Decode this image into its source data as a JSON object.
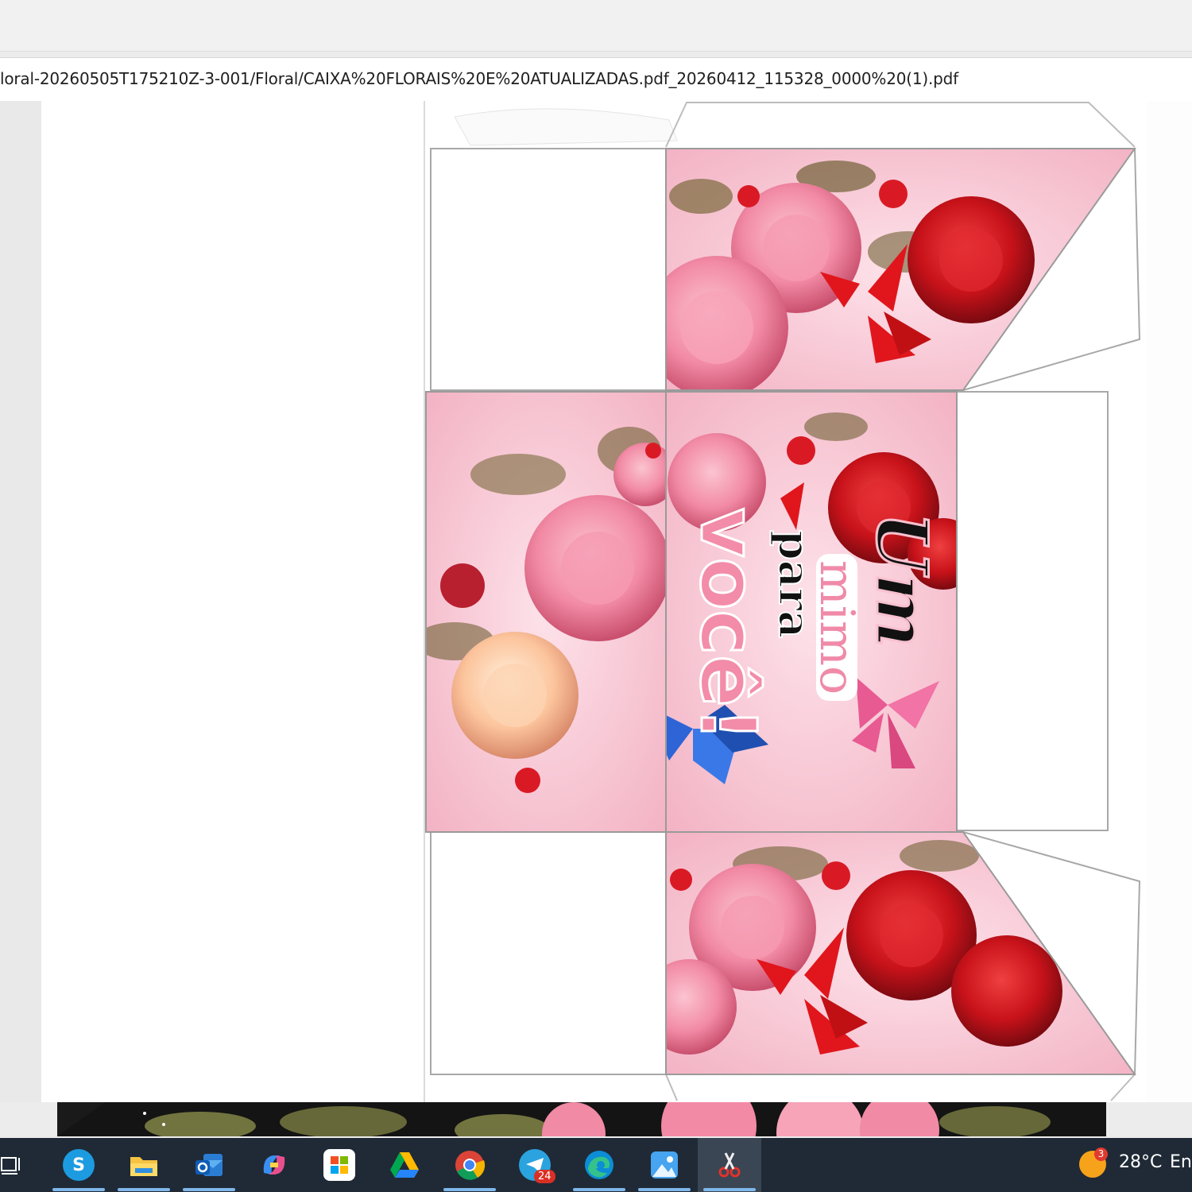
{
  "browser": {
    "url": "loral-20260505T175210Z-3-001/Floral/CAIXA%20FLORAIS%20E%20ATUALIZADAS.pdf_20260412_115328_0000%20(1).pdf"
  },
  "document": {
    "title_line1": "Um",
    "title_line2": "mimo",
    "title_line3": "para",
    "title_line4": "você!"
  },
  "taskbar": {
    "items": [
      {
        "name": "task-view-icon",
        "glyph": "⊟"
      },
      {
        "name": "skype-icon",
        "glyph": "S"
      },
      {
        "name": "file-explorer-icon",
        "glyph": "▬"
      },
      {
        "name": "outlook-icon",
        "glyph": "O"
      },
      {
        "name": "copilot-icon",
        "glyph": "✦"
      },
      {
        "name": "microsoft-store-icon",
        "glyph": "▦"
      },
      {
        "name": "google-drive-icon",
        "glyph": "▲"
      },
      {
        "name": "chrome-icon",
        "glyph": "◉"
      },
      {
        "name": "telegram-icon",
        "glyph": "➤"
      },
      {
        "name": "edge-icon",
        "glyph": "e"
      },
      {
        "name": "photos-icon",
        "glyph": "▨"
      },
      {
        "name": "snipping-tool-icon",
        "glyph": "✂"
      }
    ],
    "telegram_badge": "24",
    "weather_badge": "3",
    "temperature": "28°C",
    "language": "En"
  },
  "colors": {
    "taskbar_bg": "#1f2a36",
    "pink_panel": "#f6c2cf",
    "rose_red": "#d0121b",
    "rose_pink": "#f58aa7",
    "accent": "#7fb7ea"
  }
}
